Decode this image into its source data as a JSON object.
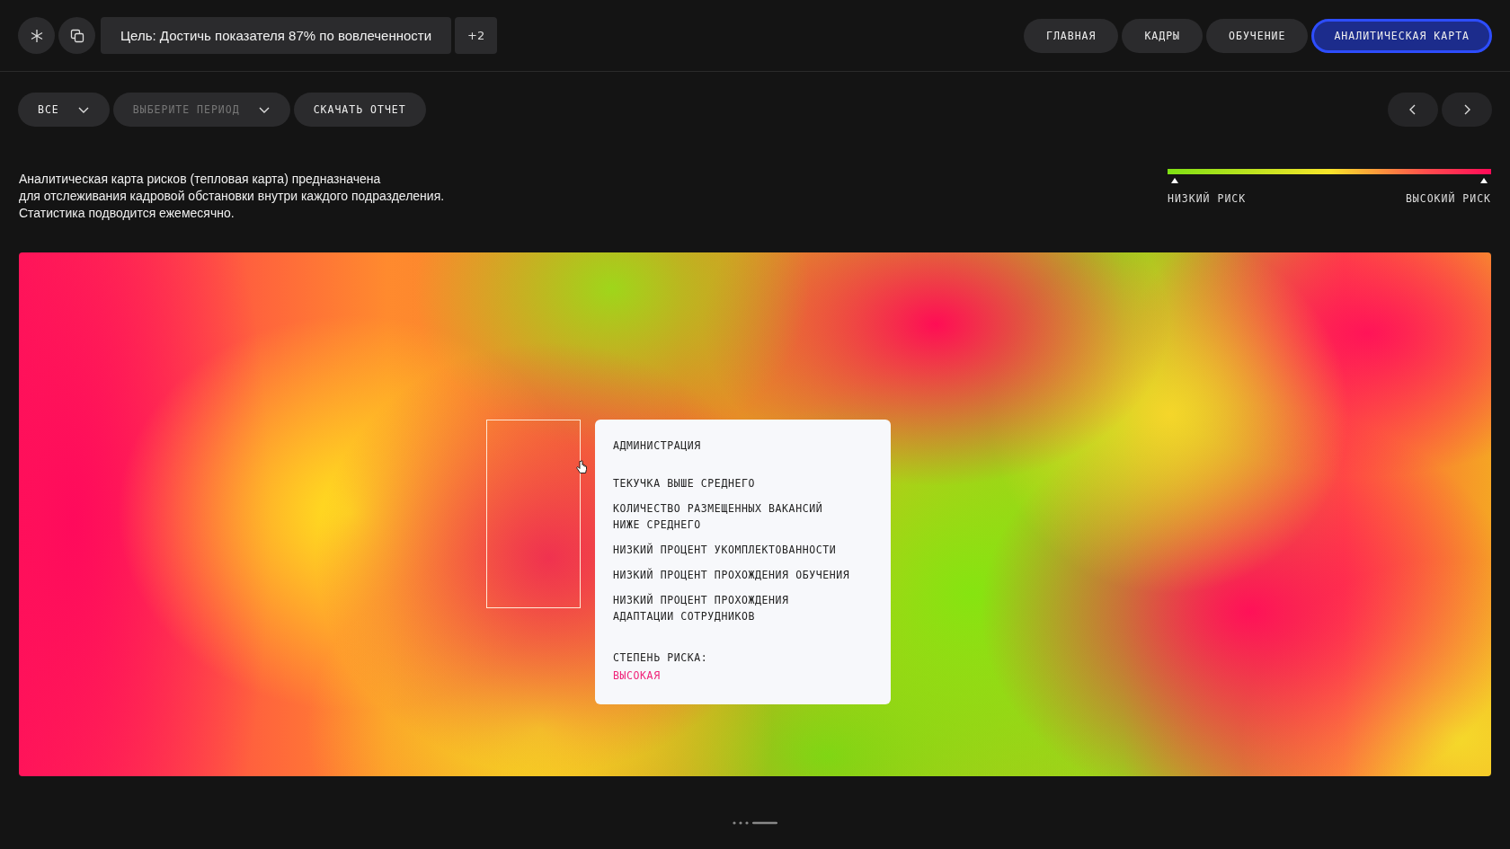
{
  "header": {
    "goal": "Цель: Достичь показателя 87% по вовлеченности",
    "goal_extra": "+2",
    "nav": [
      {
        "label": "ГЛАВНАЯ",
        "selected": false
      },
      {
        "label": "КАДРЫ",
        "selected": false
      },
      {
        "label": "ОБУЧЕНИЕ",
        "selected": false
      },
      {
        "label": "АНАЛИТИЧЕСКАЯ КАРТА",
        "selected": true
      }
    ]
  },
  "toolbar": {
    "department_filter": {
      "value": "ВСЕ"
    },
    "period_filter": {
      "placeholder": "ВЫБЕРИТЕ ПЕРИОД"
    },
    "download_button": "СКАЧАТЬ ОТЧЕТ"
  },
  "description": "Аналитическая карта рисков (тепловая карта) предназначена\nдля отслеживания кадровой обстановки внутри каждого подразделения.\nСтатистика подводится ежемесячно.",
  "legend": {
    "low_label": "НИЗКИЙ РИСК",
    "high_label": "ВЫСОКИЙ РИСК"
  },
  "tooltip": {
    "title": "АДМИНИСТРАЦИЯ",
    "items": [
      "ТЕКУЧКА ВЫШЕ СРЕДНЕГО",
      "КОЛИЧЕСТВО РАЗМЕЩЕННЫХ ВАКАНСИЙ\nНИЖЕ СРЕДНЕГО",
      "НИЗКИЙ ПРОЦЕНТ УКОМПЛЕКТОВАННОСТИ",
      "НИЗКИЙ ПРОЦЕНТ ПРОХОЖДЕНИЯ ОБУЧЕНИЯ",
      "НИЗКИЙ ПРОЦЕНТ ПРОХОЖДЕНИЯ\nАДАПТАЦИИ СОТРУДНИКОВ"
    ],
    "risk_label": "СТЕПЕНЬ РИСКА:",
    "risk_value": "ВЫСОКАЯ"
  }
}
